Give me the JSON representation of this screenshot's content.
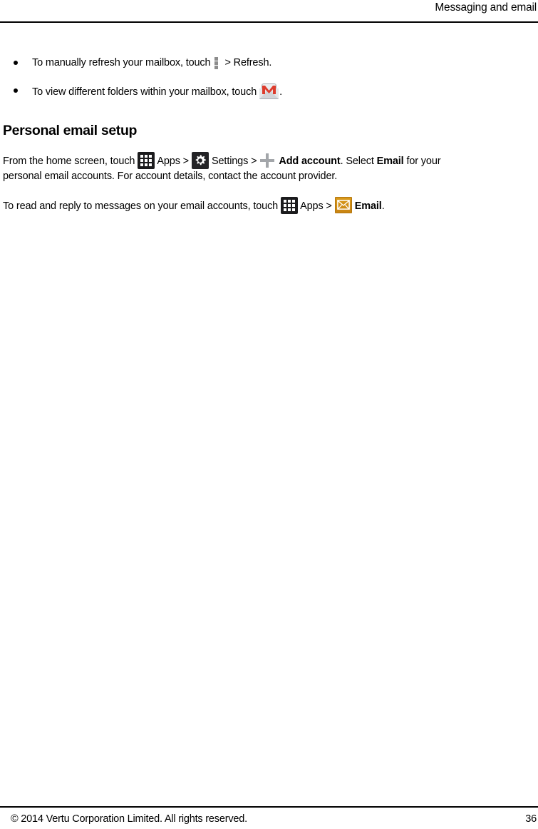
{
  "header": {
    "title": "Messaging and email"
  },
  "bullets": [
    {
      "text_before": "To manually refresh your mailbox, touch",
      "icon": "overflow-menu-icon",
      "text_after": "> Refresh."
    },
    {
      "text_before": "To view different folders within your mailbox, touch",
      "icon": "gmail-envelope-icon",
      "text_after": "."
    }
  ],
  "section": {
    "heading": "Personal email setup",
    "paragraph1": {
      "line1": {
        "seg1": "From the home screen, touch",
        "icon1": "apps-launcher-icon",
        "seg2": "Apps >",
        "icon2": "settings-gear-icon",
        "seg3": "Settings >",
        "icon3": "plus-icon",
        "seg4": "Add account",
        "seg5": ". Select",
        "seg6": "Email",
        "seg7": "for your"
      },
      "line2": "personal email accounts. For account details, contact the account provider."
    },
    "paragraph2": {
      "seg1": "To read and reply to messages on your email accounts, touch",
      "icon1": "apps-launcher-icon",
      "seg2": "Apps >",
      "icon2": "email-app-icon",
      "seg3": "Email",
      "seg4": "."
    }
  },
  "footer": {
    "copyright": "© 2014 Vertu Corporation Limited. All rights reserved.",
    "page_number": "36"
  },
  "colors": {
    "text": "#000000",
    "rule": "#000000",
    "overflow_dots": "#8c8c8c",
    "plus": "#a3a6aa",
    "apps_icon_bg": "#1b1b1d",
    "settings_icon_bg": "#232326",
    "email_icon_bg": "#d99a1a",
    "gmail_red": "#dd3c2d",
    "gmail_envelope": "#d2d4d8"
  }
}
